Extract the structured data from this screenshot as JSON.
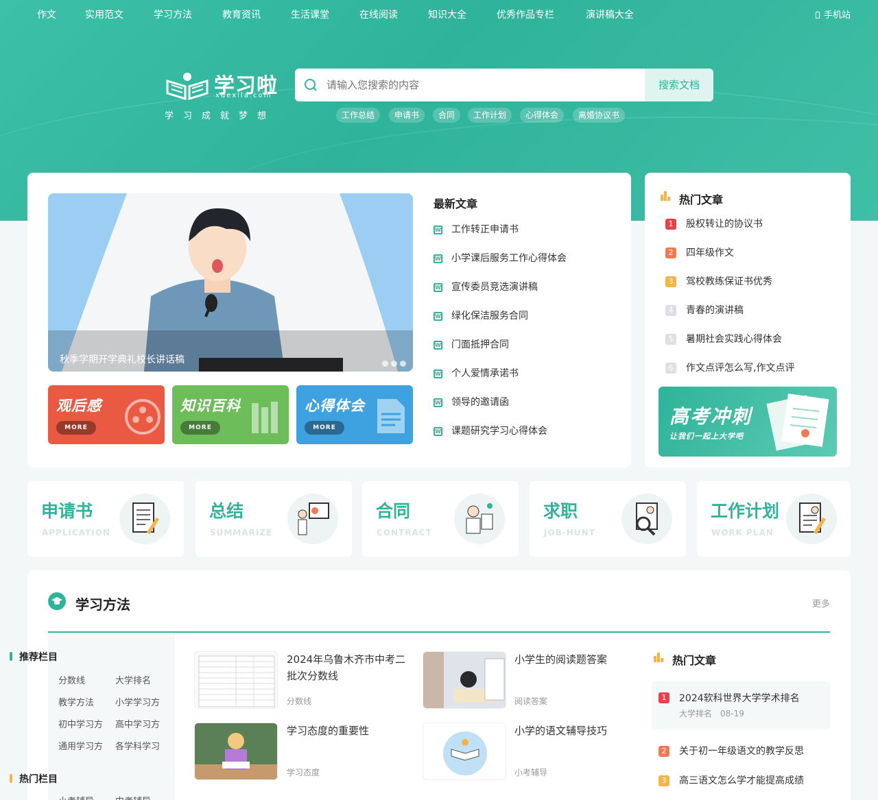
{
  "nav": {
    "items": [
      "作文",
      "实用范文",
      "学习方法",
      "教育资讯",
      "生活课堂",
      "在线阅读",
      "知识大全",
      "优秀作品专栏",
      "演讲稿大全"
    ],
    "mobile": "手机站"
  },
  "logo": {
    "brand": "学习啦",
    "domain": "xuexila.com",
    "slogan": "学习成就梦想"
  },
  "search": {
    "placeholder": "请输入您搜索的内容",
    "button": "搜索文档"
  },
  "hotkeys": [
    "工作总结",
    "申请书",
    "合同",
    "工作计划",
    "心得体会",
    "离婚协议书"
  ],
  "banner": {
    "caption": "秋季学期开学典礼校长讲话稿"
  },
  "tiles": [
    {
      "title": "观后感",
      "more": "MORE",
      "color": "#ea5a43"
    },
    {
      "title": "知识百科",
      "more": "MORE",
      "color": "#6dbe5a"
    },
    {
      "title": "心得体会",
      "more": "MORE",
      "color": "#3fa2e0"
    }
  ],
  "latest": {
    "title": "最新文章",
    "items": [
      "工作转正申请书",
      "小学课后服务工作心得体会",
      "宣传委员竞选演讲稿",
      "绿化保洁服务合同",
      "门面抵押合同",
      "个人爱情承诺书",
      "领导的邀请函",
      "课题研究学习心得体会"
    ]
  },
  "hot": {
    "title": "热门文章",
    "items": [
      "股权转让的协议书",
      "四年级作文",
      "驾校教练保证书优秀",
      "青春的演讲稿",
      "暑期社会实践心得体会",
      "作文点评怎么写,作文点评"
    ]
  },
  "gaokao": {
    "title": "高考冲刺",
    "sub": "让我们一起上大学吧"
  },
  "categories": [
    {
      "cn": "申请书",
      "en": "APPLICATION"
    },
    {
      "cn": "总结",
      "en": "SUMMARIZE"
    },
    {
      "cn": "合同",
      "en": "CONTRACT"
    },
    {
      "cn": "求职",
      "en": "JOB-HUNT"
    },
    {
      "cn": "工作计划",
      "en": "WORK PLAN"
    }
  ],
  "study": {
    "title": "学习方法",
    "more": "更多",
    "sidebar": {
      "recommend": "推荐栏目",
      "links": [
        "分数线",
        "大学排名",
        "教学方法",
        "小学学习方",
        "初中学习方",
        "高中学习方",
        "通用学习方",
        "各学科学习"
      ],
      "hot": "热门栏目",
      "hot_links": [
        "小考辅导",
        "中考辅导"
      ]
    },
    "list": [
      {
        "title": "2024年乌鲁木齐市中考二批次分数线",
        "tag": "分数线"
      },
      {
        "title": "小学生的阅读题答案",
        "tag": "阅读答案"
      },
      {
        "title": "学习态度的重要性",
        "tag": "学习态度"
      },
      {
        "title": "小学的语文辅导技巧",
        "tag": "小考辅导"
      }
    ],
    "hot": {
      "title": "热门文章",
      "top": {
        "title": "2024软科世界大学学术排名",
        "tag": "大学排名",
        "date": "08-19"
      },
      "items": [
        "关于初一年级语文的教学反思",
        "高三语文怎么学才能提高成绩"
      ]
    }
  },
  "colors": {
    "accent": "#2fb39a",
    "rank1": "#e6424b",
    "rank2": "#f07b53",
    "rank3": "#f3b54a"
  }
}
